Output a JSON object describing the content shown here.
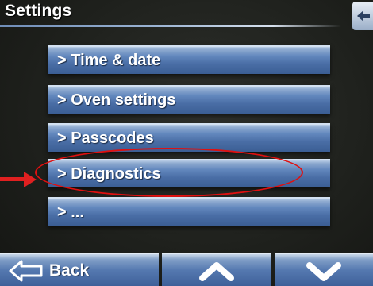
{
  "screen": {
    "title": "Settings"
  },
  "menu": {
    "items": [
      {
        "label": "> Time & date"
      },
      {
        "label": "> Oven settings"
      },
      {
        "label": "> Passcodes"
      },
      {
        "label": "> Diagnostics"
      },
      {
        "label": "> ..."
      }
    ]
  },
  "navigation": {
    "back_label": "Back",
    "up_icon": "chevron-up-icon",
    "down_icon": "chevron-down-icon",
    "back_icon": "back-arrow-icon"
  },
  "annotation": {
    "highlighted_item": "> Diagnostics",
    "color": "#e01010"
  },
  "colors": {
    "button_blue": "#4a6ea6",
    "background": "#1f211d"
  }
}
